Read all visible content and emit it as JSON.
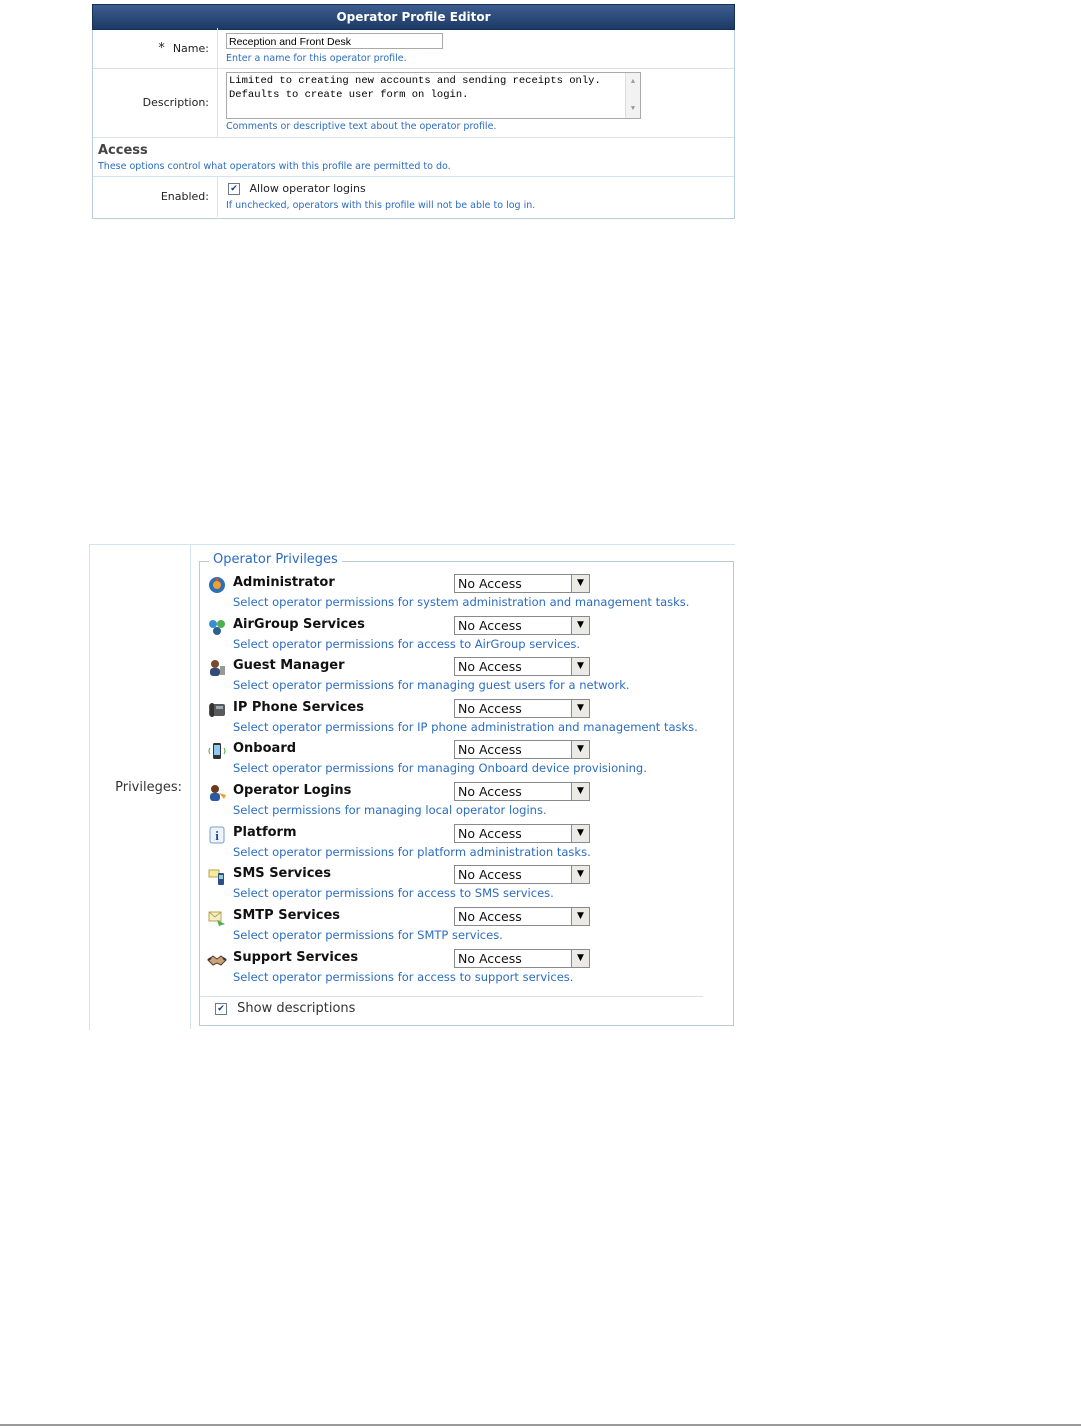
{
  "editor": {
    "title": "Operator Profile Editor",
    "name": {
      "required_mark": "*",
      "label": "Name:",
      "value": "Reception and Front Desk",
      "hint": "Enter a name for this operator profile."
    },
    "description": {
      "label": "Description:",
      "value": "Limited to creating new accounts and sending receipts only. Defaults to create user form on login.",
      "hint": "Comments or descriptive text about the operator profile."
    },
    "access": {
      "heading": "Access",
      "hint": "These options control what operators with this profile are permitted to do."
    },
    "enabled": {
      "label": "Enabled:",
      "checkbox_label": "Allow operator logins",
      "checked": true,
      "hint": "If unchecked, operators with this profile will not be able to log in."
    }
  },
  "privileges": {
    "label": "Privileges:",
    "legend": "Operator Privileges",
    "items": [
      {
        "icon": "administrator-icon",
        "name": "Administrator",
        "value": "No Access",
        "desc": "Select operator permissions for system administration and management tasks."
      },
      {
        "icon": "airgroup-icon",
        "name": "AirGroup Services",
        "value": "No Access",
        "desc": "Select operator permissions for access to AirGroup services."
      },
      {
        "icon": "guest-manager-icon",
        "name": "Guest Manager",
        "value": "No Access",
        "desc": "Select operator permissions for managing guest users for a network."
      },
      {
        "icon": "ip-phone-icon",
        "name": "IP Phone Services",
        "value": "No Access",
        "desc": "Select operator permissions for IP phone administration and management tasks."
      },
      {
        "icon": "onboard-phone-icon",
        "name": "Onboard",
        "value": "No Access",
        "desc": "Select operator permissions for managing Onboard device provisioning."
      },
      {
        "icon": "operator-logins-icon",
        "name": "Operator Logins",
        "value": "No Access",
        "desc": "Select permissions for managing local operator logins."
      },
      {
        "icon": "platform-info-icon",
        "name": "Platform",
        "value": "No Access",
        "desc": "Select operator permissions for platform administration tasks."
      },
      {
        "icon": "sms-icon",
        "name": "SMS Services",
        "value": "No Access",
        "desc": "Select operator permissions for access to SMS services."
      },
      {
        "icon": "smtp-icon",
        "name": "SMTP Services",
        "value": "No Access",
        "desc": "Select operator permissions for SMTP services."
      },
      {
        "icon": "support-handshake-icon",
        "name": "Support Services",
        "value": "No Access",
        "desc": "Select operator permissions for access to support services."
      }
    ],
    "show_descriptions": {
      "label": "Show descriptions",
      "checked": true
    }
  },
  "colors": {
    "header": "#1d3a66",
    "hint": "#2a6cc2",
    "border": "#d5e3ef"
  }
}
